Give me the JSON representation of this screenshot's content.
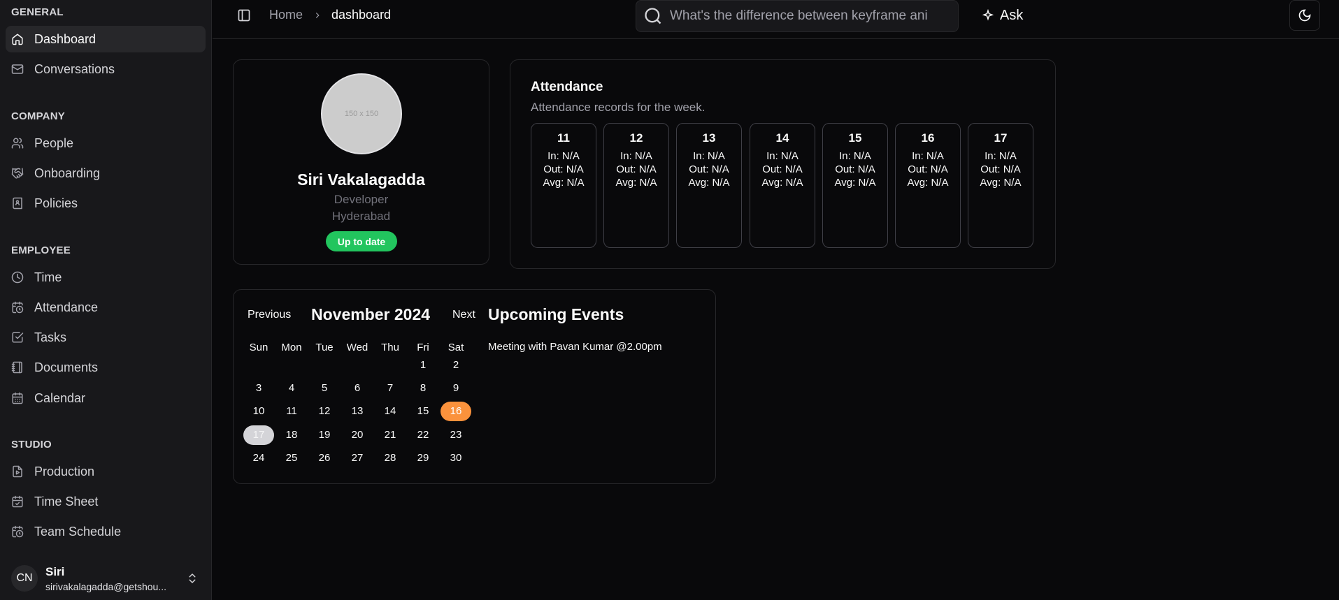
{
  "sidebar": {
    "groups": [
      {
        "label": "GENERAL"
      },
      {
        "label": "COMPANY"
      },
      {
        "label": "EMPLOYEE"
      },
      {
        "label": "STUDIO"
      }
    ],
    "items": [
      {
        "label": "Dashboard",
        "icon": "home-icon",
        "active": true
      },
      {
        "label": "Conversations",
        "icon": "mail-icon"
      },
      {
        "label": "People",
        "icon": "users-icon"
      },
      {
        "label": "Onboarding",
        "icon": "handshake-icon"
      },
      {
        "label": "Policies",
        "icon": "book-user-icon"
      },
      {
        "label": "Time",
        "icon": "clock-icon"
      },
      {
        "label": "Attendance",
        "icon": "calendar-clock-icon"
      },
      {
        "label": "Tasks",
        "icon": "check-square-icon"
      },
      {
        "label": "Documents",
        "icon": "notebook-icon"
      },
      {
        "label": "Calendar",
        "icon": "calendar-days-icon"
      },
      {
        "label": "Production",
        "icon": "file-video-icon"
      },
      {
        "label": "Time Sheet",
        "icon": "calendar-check-icon"
      },
      {
        "label": "Team Schedule",
        "icon": "calendar-clock-icon"
      }
    ],
    "user": {
      "initials": "CN",
      "name": "Siri",
      "email": "sirivakalagadda@getshou..."
    }
  },
  "header": {
    "breadcrumb_home": "Home",
    "breadcrumb_current": "dashboard",
    "search_value": "What's the difference between keyframe ani",
    "ask_label": "Ask"
  },
  "profile": {
    "photo_placeholder": "150 x 150",
    "name": "Siri Vakalagadda",
    "role": "Developer",
    "location": "Hyderabad",
    "status": "Up to date",
    "status_color": "#22c55e"
  },
  "attendance": {
    "title": "Attendance",
    "subtitle": "Attendance records for the week.",
    "days": [
      {
        "day": "11",
        "in": "In: N/A",
        "out": "Out: N/A",
        "avg": "Avg: N/A"
      },
      {
        "day": "12",
        "in": "In: N/A",
        "out": "Out: N/A",
        "avg": "Avg: N/A"
      },
      {
        "day": "13",
        "in": "In: N/A",
        "out": "Out: N/A",
        "avg": "Avg: N/A"
      },
      {
        "day": "14",
        "in": "In: N/A",
        "out": "Out: N/A",
        "avg": "Avg: N/A"
      },
      {
        "day": "15",
        "in": "In: N/A",
        "out": "Out: N/A",
        "avg": "Avg: N/A"
      },
      {
        "day": "16",
        "in": "In: N/A",
        "out": "Out: N/A",
        "avg": "Avg: N/A"
      },
      {
        "day": "17",
        "in": "In: N/A",
        "out": "Out: N/A",
        "avg": "Avg: N/A"
      }
    ]
  },
  "calendar": {
    "prev_label": "Previous",
    "month_label": "November 2024",
    "next_label": "Next",
    "weekdays": [
      "Sun",
      "Mon",
      "Tue",
      "Wed",
      "Thu",
      "Fri",
      "Sat"
    ],
    "weeks": [
      [
        "",
        "",
        "",
        "",
        "",
        "1",
        "2"
      ],
      [
        "3",
        "4",
        "5",
        "6",
        "7",
        "8",
        "9"
      ],
      [
        "10",
        "11",
        "12",
        "13",
        "14",
        "15",
        "16"
      ],
      [
        "17",
        "18",
        "19",
        "20",
        "21",
        "22",
        "23"
      ],
      [
        "24",
        "25",
        "26",
        "27",
        "28",
        "29",
        "30"
      ]
    ],
    "today": "16",
    "selected": "17",
    "today_color": "#fb923c"
  },
  "events": {
    "title": "Upcoming Events",
    "items": [
      "Meeting with Pavan Kumar @2.00pm"
    ]
  }
}
